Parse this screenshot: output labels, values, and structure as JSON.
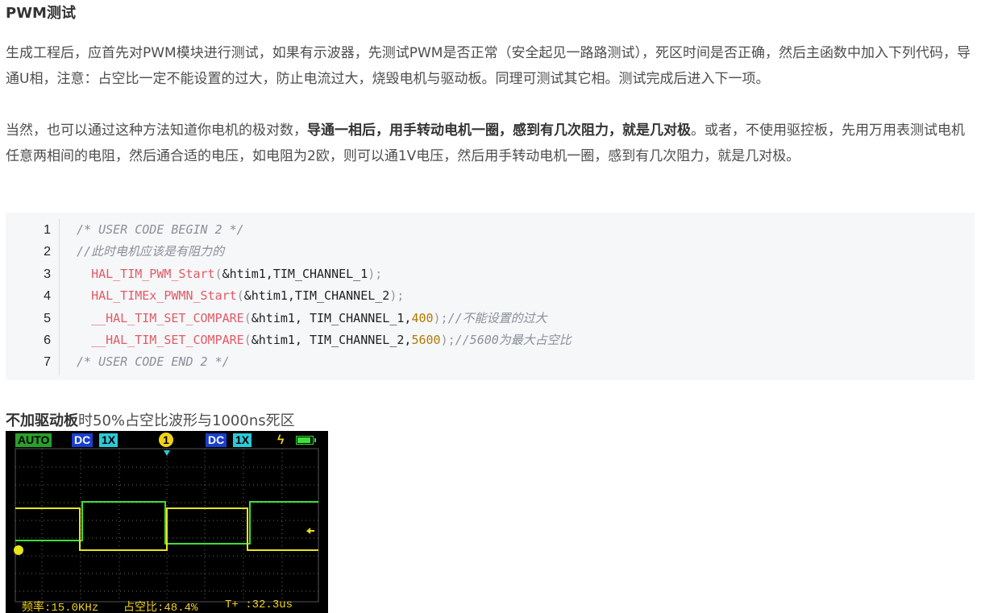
{
  "section_title": "PWM测试",
  "paragraph1": "生成工程后，应首先对PWM模块进行测试，如果有示波器，先测试PWM是否正常（安全起见一路路测试），死区时间是否正确，然后主函数中加入下列代码，导通U相，注意：占空比一定不能设置的过大，防止电流过大，烧毁电机与驱动板。同理可测试其它相。测试完成后进入下一项。",
  "paragraph2": {
    "before": "当然，也可以通过这种方法知道你电机的极对数，",
    "bold": "导通一相后，用手转动电机一圈，感到有几次阻力，就是几对极",
    "after": "。或者，不使用驱控板，先用万用表测试电机任意两相间的电阻，然后通合适的电压，如电阻为2欧，则可以通1V电压，然后用手转动电机一圈，感到有几次阻力，就是几对极。"
  },
  "code": {
    "line_numbers": [
      "1",
      "2",
      "3",
      "4",
      "5",
      "6",
      "7"
    ],
    "line1": "/* USER CODE BEGIN 2 */",
    "line2": "//此时电机应该是有阻力的",
    "line3_fn": "HAL_TIM_PWM_Start",
    "line3_args": "&htim1,TIM_CHANNEL_1",
    "line4_fn": "HAL_TIMEx_PWMN_Start",
    "line4_args": "&htim1,TIM_CHANNEL_2",
    "line5_fn": "__HAL_TIM_SET_COMPARE",
    "line5_args": "&htim1, TIM_CHANNEL_1,",
    "line5_num": "400",
    "line5_comment": "//不能设置的过大",
    "line6_fn": "__HAL_TIM_SET_COMPARE",
    "line6_args": "&htim1, TIM_CHANNEL_2,",
    "line6_num": "5600",
    "line6_comment": "//5600为最大占空比",
    "line7": "/* USER CODE END 2 */"
  },
  "caption": {
    "bold": "不加驱动板",
    "rest": "时50%占空比波形与1000ns死区"
  },
  "scope": {
    "mode": "AUTO",
    "ch1_coupling": "DC",
    "ch1_probe": "1X",
    "channel": "1",
    "ch2_coupling": "DC",
    "ch2_probe": "1X",
    "trigger_symbol": "ϟ",
    "freq_label": "频率:",
    "freq_value": "15.0KHz",
    "duty_label": "占空比:",
    "duty_value": "48.4%",
    "period_label": "T+ :",
    "period_value": "32.3us",
    "colors": {
      "green_trace": "#3ae03a",
      "yellow_trace": "#e8e41e"
    }
  }
}
